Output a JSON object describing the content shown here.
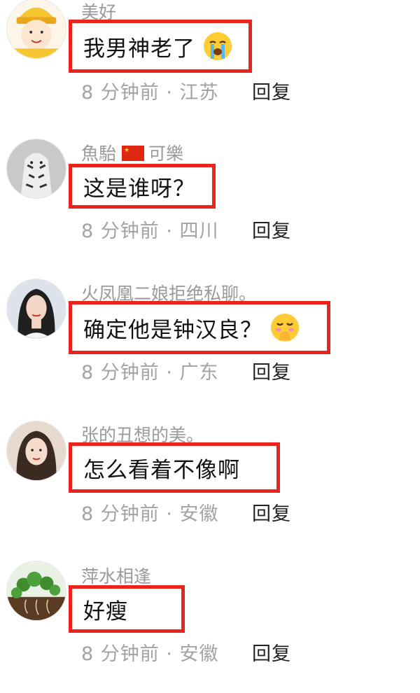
{
  "comments": [
    {
      "username": "美好",
      "flag": false,
      "username_suffix": "",
      "text": "我男神老了",
      "emoji": "loudly-crying-face",
      "meta": "8 分钟前 · 江苏",
      "reply": "回复"
    },
    {
      "username": "魚駘",
      "flag": true,
      "username_suffix": "可樂",
      "text": "这是谁呀？",
      "emoji": "",
      "meta": "8 分钟前 · 四川",
      "reply": "回复"
    },
    {
      "username": "火凤凰二娘拒绝私聊。",
      "flag": false,
      "username_suffix": "",
      "text": "确定他是钟汉良？",
      "emoji": "face-with-hand-over-mouth",
      "meta": "8 分钟前 · 广东",
      "reply": "回复"
    },
    {
      "username": "张的丑想的美。",
      "flag": false,
      "username_suffix": "",
      "text": "怎么看着不像啊",
      "emoji": "",
      "meta": "8 分钟前 · 安徽",
      "reply": "回复"
    },
    {
      "username": "萍水相逢",
      "flag": false,
      "username_suffix": "",
      "text": "好瘦",
      "emoji": "",
      "meta": "8 分钟前 · 安徽",
      "reply": "回复"
    }
  ],
  "colors": {
    "highlight_border": "#e8241d",
    "username": "#9a9a9a",
    "meta": "#a3a3a3"
  }
}
